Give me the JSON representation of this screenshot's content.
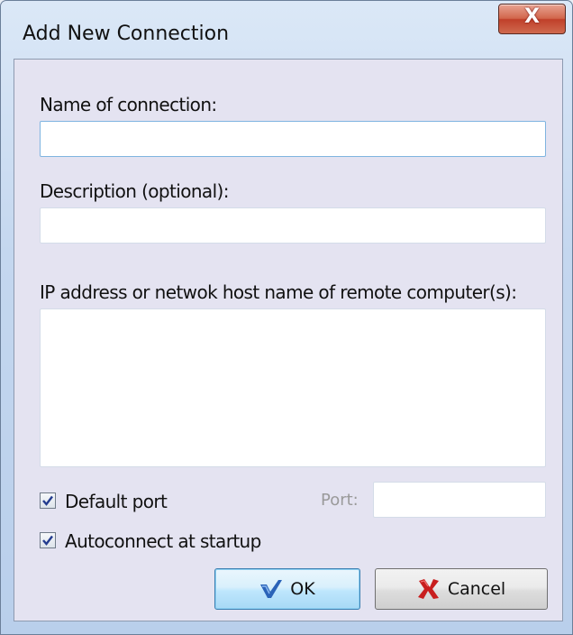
{
  "window": {
    "title": "Add New Connection",
    "close_glyph": "X"
  },
  "form": {
    "name_label": "Name of connection:",
    "name_value": "",
    "description_label": "Description (optional):",
    "description_value": "",
    "host_label": "IP address or netwok host name of remote computer(s):",
    "host_value": "",
    "default_port_label": "Default port",
    "default_port_checked": true,
    "port_label": "Port:",
    "port_value": "",
    "autoconnect_label": "Autoconnect at startup",
    "autoconnect_checked": true
  },
  "buttons": {
    "ok_label": "OK",
    "ok_icon": "checkmark-icon",
    "cancel_label": "Cancel",
    "cancel_icon": "cross-icon"
  },
  "colors": {
    "ok_icon": "#2a63b8",
    "cancel_icon": "#c81e1e",
    "close_button": "#c9482f"
  }
}
